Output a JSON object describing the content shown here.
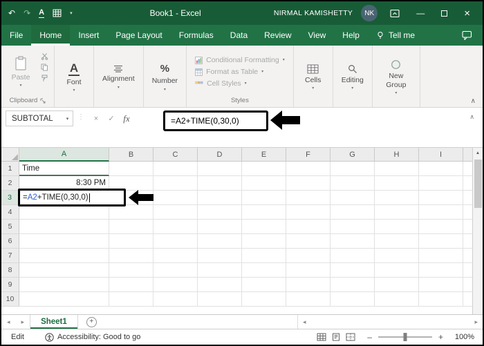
{
  "colors": {
    "excel_green": "#217346",
    "title_green": "#185c37",
    "reference_blue": "#2a5bd7",
    "annotation_black": "#000000"
  },
  "icons": {
    "undo": "↶",
    "redo": "↷",
    "underline_a": "A",
    "caret_down": "▾",
    "minimize": "—",
    "close": "×",
    "cancel": "×",
    "check": "✓",
    "collapse": "∧",
    "up_arrow": "▲",
    "left_small": "◂",
    "right_small": "▸",
    "plus": "+",
    "minus": "–",
    "dots": "⋮"
  },
  "title_bar": {
    "title": "Book1 - Excel",
    "user_name": "NIRMAL KAMISHETTY",
    "user_initials": "NK"
  },
  "tabs": {
    "items": [
      "File",
      "Home",
      "Insert",
      "Page Layout",
      "Formulas",
      "Data",
      "Review",
      "View",
      "Help"
    ],
    "active": "Home",
    "tell_me": "Tell me"
  },
  "ribbon": {
    "clipboard": {
      "paste_label": "Paste",
      "caption": "Clipboard"
    },
    "font": {
      "letter": "A",
      "caption": "Font"
    },
    "alignment": {
      "caption": "Alignment"
    },
    "number": {
      "symbol": "%",
      "caption": "Number"
    },
    "styles": {
      "items": [
        "Conditional Formatting",
        "Format as Table",
        "Cell Styles"
      ],
      "caption": "Styles"
    },
    "cells": {
      "caption": "Cells"
    },
    "editing": {
      "caption": "Editing"
    },
    "new_group": {
      "caption": "New Group"
    }
  },
  "formula_bar": {
    "name_box": "SUBTOTAL",
    "fx": "fx",
    "formula": "=A2+TIME(0,30,0)"
  },
  "grid": {
    "columns": [
      "A",
      "B",
      "C",
      "D",
      "E",
      "F",
      "G",
      "H",
      "I"
    ],
    "rows": [
      "1",
      "2",
      "3",
      "4",
      "5",
      "6",
      "7",
      "8",
      "9",
      "10"
    ],
    "active_row": "3",
    "active_column": "A",
    "cells": {
      "A1": "Time",
      "A2": "8:30 PM"
    },
    "edit_cell": {
      "ref": "A3",
      "prefix": "=",
      "reference": "A2",
      "suffix": "+TIME(0,30,0)"
    }
  },
  "sheet_bar": {
    "sheet_name": "Sheet1"
  },
  "status_bar": {
    "mode": "Edit",
    "accessibility": "Accessibility: Good to go",
    "zoom": "100%"
  }
}
